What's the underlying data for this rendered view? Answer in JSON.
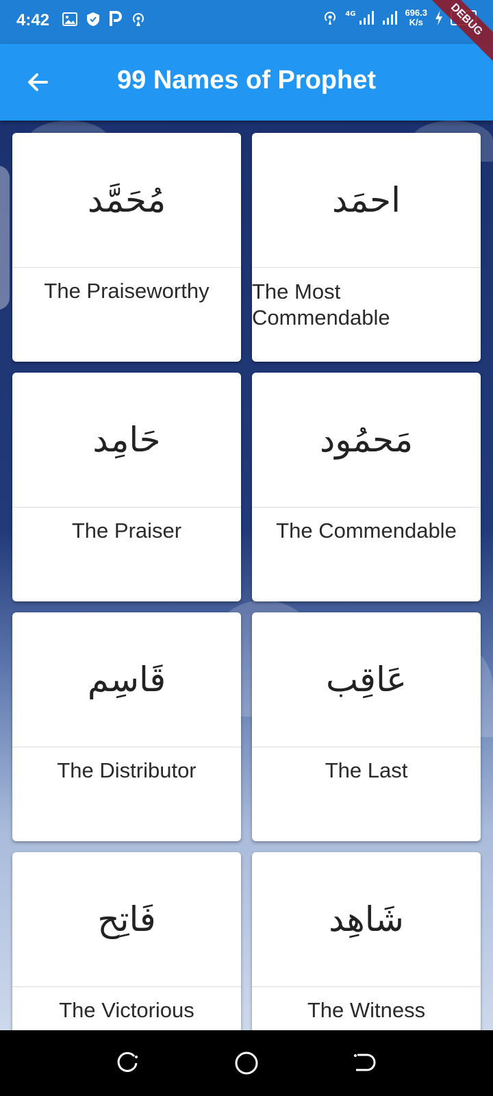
{
  "status_bar": {
    "time": "4:42",
    "net_type": "4G",
    "speed_value": "696.3",
    "speed_unit": "K/s",
    "battery": "66",
    "debug_label": "DEBUG",
    "icons": [
      "gallery-icon",
      "shield-check-icon",
      "p-app-icon",
      "hotspot-icon",
      "hotspot-icon",
      "signal-icon",
      "signal-icon",
      "charging-icon",
      "battery-icon"
    ]
  },
  "app_bar": {
    "title": "99 Names of Prophet",
    "back_icon": "arrow-left-icon",
    "color": "#2196f3"
  },
  "names": [
    {
      "arabic": "مُحَمَّد",
      "english": "The Praiseworthy"
    },
    {
      "arabic": "احمَد",
      "english": "The Most Commendable"
    },
    {
      "arabic": "حَامِد",
      "english": "The Praiser"
    },
    {
      "arabic": "مَحمُود",
      "english": "The Commendable"
    },
    {
      "arabic": "قَاسِم",
      "english": "The Distributor"
    },
    {
      "arabic": "عَاقِب",
      "english": "The Last"
    },
    {
      "arabic": "فَاتِح",
      "english": "The Victorious"
    },
    {
      "arabic": "شَاهِد",
      "english": "The Witness"
    }
  ],
  "nav_bar": {
    "icons": [
      "recent-apps-icon",
      "home-icon",
      "back-icon"
    ]
  }
}
